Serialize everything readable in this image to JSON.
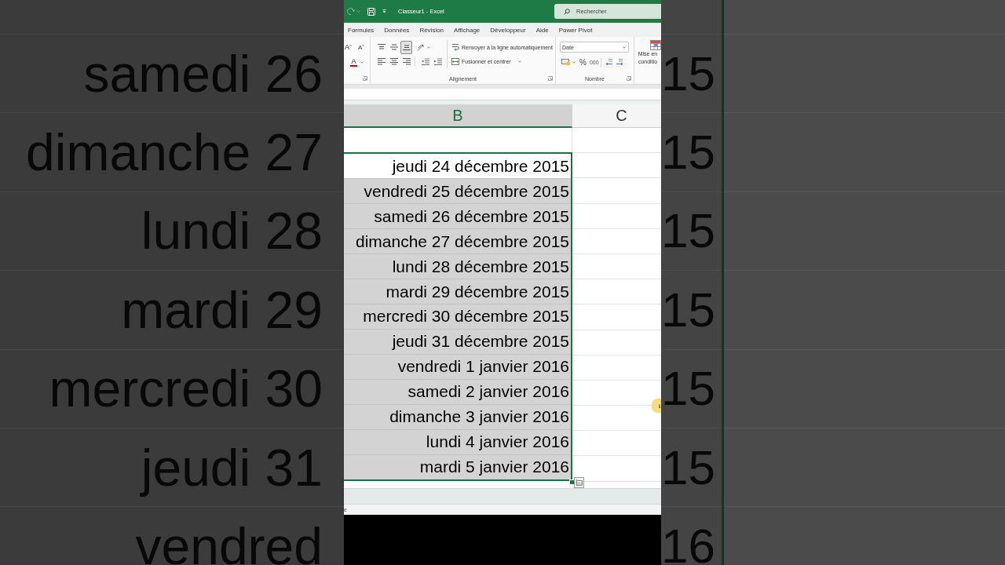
{
  "backdrop_left": {
    "rows": [
      "samedi 26",
      "dimanche 27",
      "lundi 28",
      "mardi 29",
      "mercredi 30",
      "jeudi 31",
      "vendred"
    ]
  },
  "title_bar": {
    "quick_access": [
      {
        "kind": "redo",
        "disabled": true
      },
      {
        "kind": "save",
        "disabled": false
      },
      {
        "kind": "customize",
        "disabled": false
      }
    ],
    "title": "Classeur1 - Excel",
    "search": {
      "placeholder": "Rechercher"
    }
  },
  "menu_tabs": [
    {
      "label": "Formules",
      "selected": false
    },
    {
      "label": "Données",
      "selected": false
    },
    {
      "label": "Révision",
      "selected": false
    },
    {
      "label": "Affichage",
      "selected": false
    },
    {
      "label": "Développeur",
      "selected": false
    },
    {
      "label": "Aide",
      "selected": false
    },
    {
      "label": "Power Pivot",
      "selected": false
    }
  ],
  "ribbon": {
    "font_group": {
      "buttons": [
        {
          "kind": "grow",
          "label": "A"
        },
        {
          "kind": "shrink",
          "label": "A"
        },
        {
          "kind": "font_color",
          "label": "A"
        }
      ]
    },
    "alignment_group": {
      "label": "Alignement",
      "vertical": [
        {
          "kind": "top",
          "selected": false
        },
        {
          "kind": "middle",
          "selected": false
        },
        {
          "kind": "bottom",
          "selected": true
        }
      ],
      "horizontal": [
        {
          "kind": "left",
          "selected": false
        },
        {
          "kind": "center",
          "selected": false
        },
        {
          "kind": "right",
          "selected": false
        }
      ],
      "wrap_text": {
        "label": "Renvoyer à la ligne automatiquement"
      },
      "merge": {
        "label": "Fusionner et centrer"
      }
    },
    "number_group": {
      "label": "Nombre",
      "format": {
        "value": "Date"
      },
      "buttons": [
        {
          "kind": "accounting"
        },
        {
          "kind": "percent",
          "label": "%"
        },
        {
          "kind": "thousands",
          "label": "000"
        },
        {
          "kind": "increase_decimal"
        },
        {
          "kind": "decrease_decimal"
        }
      ]
    },
    "styles_group": {
      "conditional_formatting": {
        "label_lines": [
          "Mise en",
          "conditio"
        ]
      }
    }
  },
  "sheet": {
    "columns": [
      {
        "label": "B",
        "selected": true
      },
      {
        "label": "C",
        "selected": false
      }
    ],
    "rows": [
      {
        "selected": false,
        "active": false
      },
      {
        "text": "jeudi 24 décembre 2015",
        "selected": true,
        "active": true
      },
      {
        "text": "vendredi 25 décembre 2015",
        "selected": true,
        "active": false
      },
      {
        "text": "samedi 26 décembre 2015",
        "selected": true,
        "active": false
      },
      {
        "text": "dimanche 27 décembre 2015",
        "selected": true,
        "active": false
      },
      {
        "text": "lundi 28 décembre 2015",
        "selected": true,
        "active": false
      },
      {
        "text": "mardi 29 décembre 2015",
        "selected": true,
        "active": false
      },
      {
        "text": "mercredi 30 décembre 2015",
        "selected": true,
        "active": false
      },
      {
        "text": "jeudi 31 décembre 2015",
        "selected": true,
        "active": false
      },
      {
        "text": "vendredi 1 janvier 2016",
        "selected": true,
        "active": false
      },
      {
        "text": "samedi 2 janvier 2016",
        "selected": true,
        "active": false
      },
      {
        "text": "dimanche 3 janvier 2016",
        "selected": true,
        "active": false
      },
      {
        "text": "lundi 4 janvier 2016",
        "selected": true,
        "active": false
      },
      {
        "text": "mardi 5 janvier 2016",
        "selected": true,
        "active": false
      }
    ]
  },
  "status_bar": {
    "text": "e"
  },
  "backdrop_right": {
    "rows": [
      "15",
      "15",
      "15",
      "15",
      "15",
      "15",
      "16"
    ]
  }
}
